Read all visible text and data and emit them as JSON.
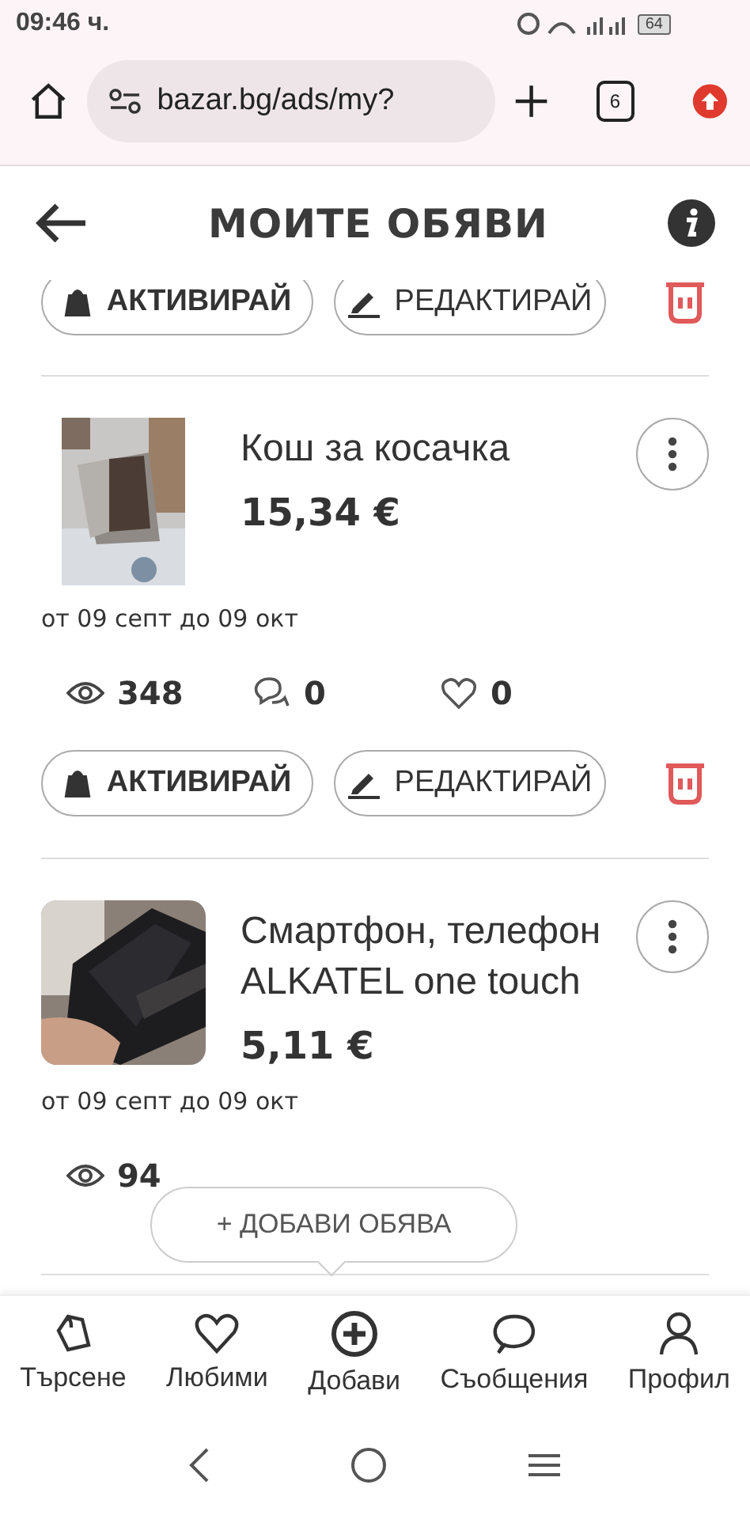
{
  "status_bar": {
    "time": "09:46 ч.",
    "battery": "64"
  },
  "browser": {
    "url": "bazar.bg/ads/my?",
    "tab_count": "6"
  },
  "header": {
    "title": "МОИТЕ ОБЯВИ"
  },
  "top_actions": {
    "activate": "АКТИВИРАЙ",
    "edit": "РЕДАКТИРАЙ"
  },
  "ads": [
    {
      "title": "Кош за косачка",
      "price": "15,34 €",
      "period": "от 09 септ до 09 окт",
      "stats": {
        "views": "348",
        "comments": "0",
        "likes": "0"
      },
      "actions": {
        "activate": "АКТИВИРАЙ",
        "edit": "РЕДАКТИРАЙ"
      }
    },
    {
      "title": "Смартфон, телефон ALKATEL one touch",
      "price": "5,11 €",
      "period": "от 09 септ до 09 окт",
      "stats": {
        "views": "94"
      }
    }
  ],
  "tooltip": {
    "label": "+ ДОБАВИ ОБЯВА"
  },
  "bottom_nav": [
    {
      "label": "Търсене"
    },
    {
      "label": "Любими"
    },
    {
      "label": "Добави"
    },
    {
      "label": "Съобщения"
    },
    {
      "label": "Профил"
    }
  ]
}
